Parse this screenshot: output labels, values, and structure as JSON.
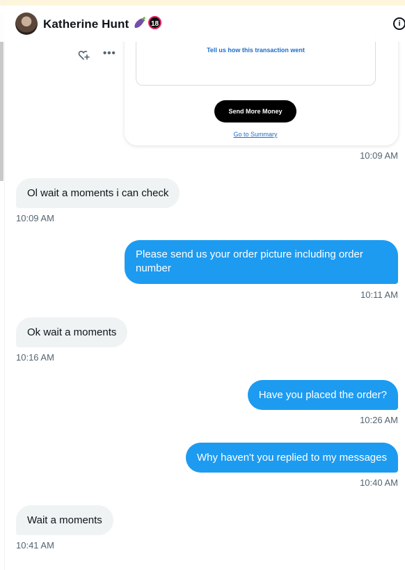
{
  "header": {
    "name": "Katherine Hunt",
    "emoji": "🍆",
    "badge": "18"
  },
  "card": {
    "prompt_text": "Tell us how this transaction went",
    "button_label": "Send More Money",
    "link_label": "Go to Summary"
  },
  "messages": [
    {
      "side": "out",
      "kind": "card",
      "time": "10:09 AM"
    },
    {
      "side": "in",
      "text": "Ol wait a moments i can check",
      "time": "10:09 AM"
    },
    {
      "side": "out",
      "text": "Please send us your order picture including order number",
      "time": "10:11 AM"
    },
    {
      "side": "in",
      "text": "Ok wait a moments",
      "time": "10:16 AM"
    },
    {
      "side": "out",
      "text": "Have you placed the order?",
      "time": "10:26 AM"
    },
    {
      "side": "out",
      "text": "Why haven't you replied to my messages",
      "time": "10:40 AM"
    },
    {
      "side": "in",
      "text": "Wait a moments",
      "time": "10:41 AM"
    }
  ],
  "colors": {
    "outgoing": "#1d9bf0",
    "incoming": "#eff3f4",
    "timestamp": "#536471"
  },
  "icons": [
    "info-icon",
    "add-reaction-icon",
    "more-options-icon"
  ]
}
